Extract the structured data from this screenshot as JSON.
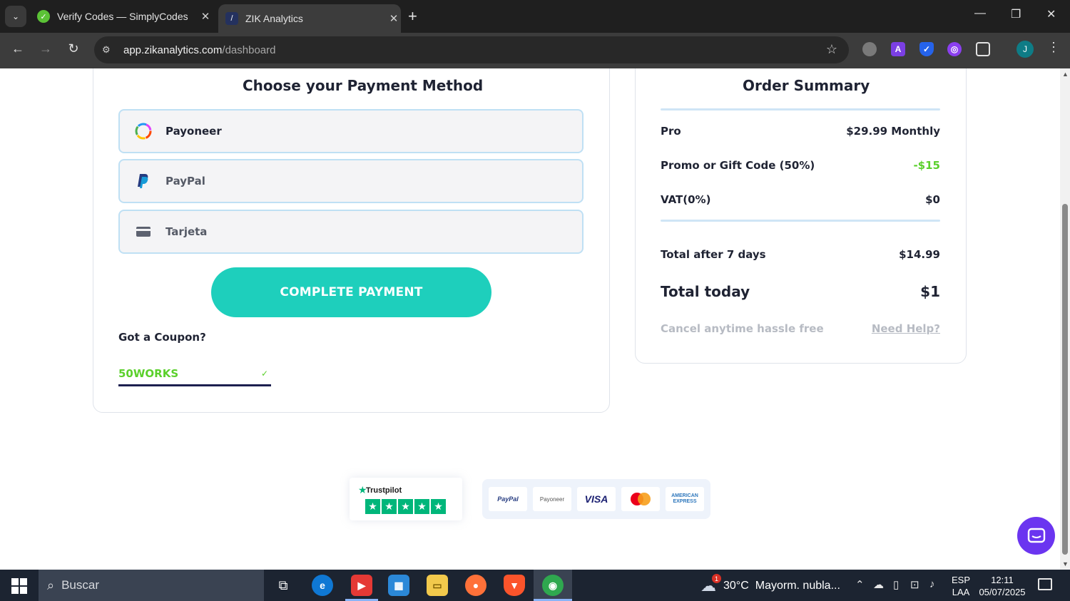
{
  "browser": {
    "tabs": [
      {
        "title": "Verify Codes — SimplyCodes",
        "active": false
      },
      {
        "title": "ZIK Analytics",
        "active": true
      }
    ],
    "url_host": "app.zikanalytics.com",
    "url_path": "/dashboard",
    "profile_initial": "J"
  },
  "payment": {
    "title": "Choose your Payment Method",
    "methods": [
      {
        "label": "Payoneer",
        "icon": "payoneer-logo-icon",
        "selected": true
      },
      {
        "label": "PayPal",
        "icon": "paypal-logo-icon",
        "selected": false
      },
      {
        "label": "Tarjeta",
        "icon": "credit-card-icon",
        "selected": false
      }
    ],
    "button_label": "COMPLETE PAYMENT",
    "coupon_label": "Got a Coupon?",
    "coupon_value": "50WORKS"
  },
  "summary": {
    "title": "Order Summary",
    "rows": [
      {
        "label": "Pro",
        "value": "$29.99 Monthly"
      },
      {
        "label": "Promo or Gift Code (50%)",
        "value": "-$15"
      },
      {
        "label": "VAT(0%)",
        "value": "$0"
      },
      {
        "label": "Total after 7 days",
        "value": "$14.99"
      },
      {
        "label": "Total today",
        "value": "$1"
      }
    ],
    "footer_left": "Cancel anytime hassle free",
    "footer_right": "Need Help?"
  },
  "badges": {
    "trustpilot": "Trustpilot",
    "cards": [
      "PayPal",
      "Payoneer",
      "VISA",
      "MasterCard",
      "AMERICAN EXPRESS"
    ]
  },
  "taskbar": {
    "search_placeholder": "Buscar",
    "weather_temp": "30°C",
    "weather_text": "Mayorm. nubla...",
    "weather_badge": "1",
    "lang_top": "ESP",
    "lang_bottom": "LAA",
    "time": "12:11",
    "date": "05/07/2025"
  },
  "colors": {
    "accent_teal": "#1ecfbc",
    "promo_green": "#5bd02c",
    "chat_purple": "#6b35f0"
  }
}
